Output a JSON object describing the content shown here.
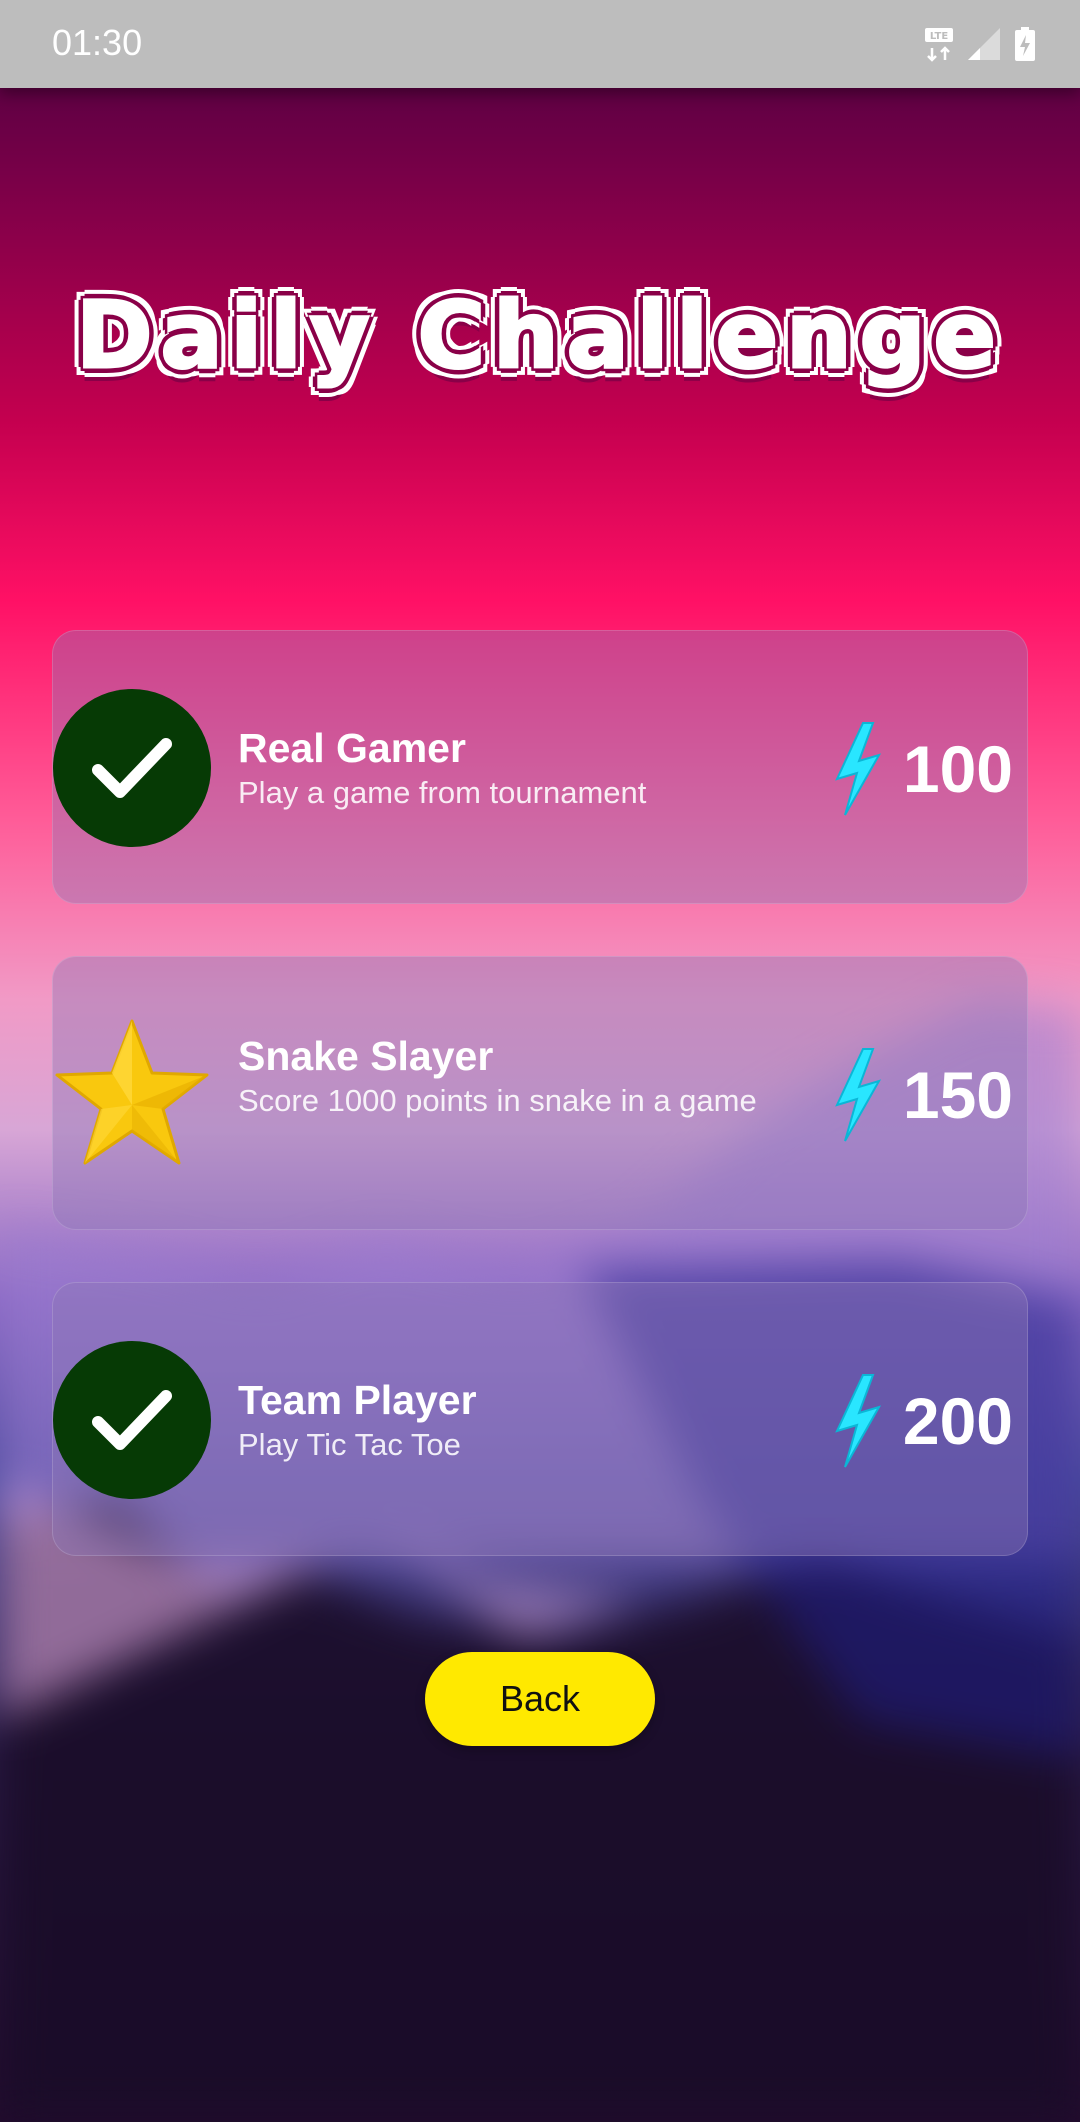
{
  "status_bar": {
    "time": "01:30",
    "icons": [
      "lte-icon",
      "signal-icon",
      "battery-charging-icon"
    ]
  },
  "page": {
    "title": "Daily Challenge"
  },
  "challenges": [
    {
      "title": "Real Gamer",
      "description": "Play a game from tournament",
      "reward": "100",
      "status_icon": "check-icon",
      "completed": true
    },
    {
      "title": "Snake Slayer",
      "description": "Score 1000 points in snake in a game",
      "reward": "150",
      "status_icon": "star-icon",
      "completed": false
    },
    {
      "title": "Team Player",
      "description": "Play Tic Tac Toe",
      "reward": "200",
      "status_icon": "check-icon",
      "completed": true
    }
  ],
  "reward_icon": "lightning-bolt-icon",
  "buttons": {
    "back_label": "Back"
  },
  "colors": {
    "check_circle": "#063a05",
    "bolt": "#29e6ff",
    "star": "#f9c80e",
    "back_button": "#ffe900"
  }
}
